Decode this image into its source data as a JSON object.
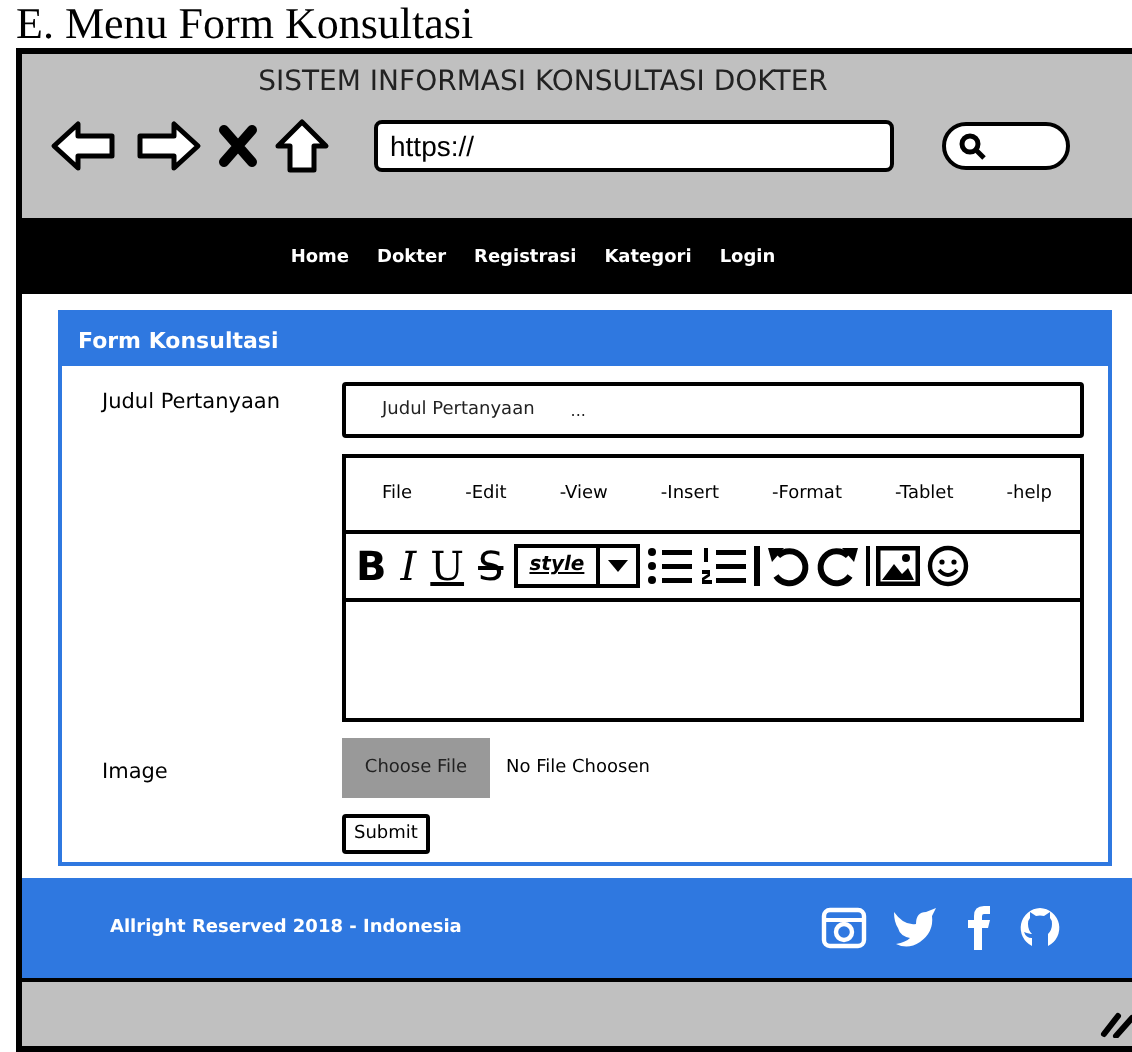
{
  "caption": "E. Menu Form Konsultasi",
  "browser": {
    "title": "SISTEM INFORMASI KONSULTASI DOKTER",
    "url": "https://"
  },
  "nav": [
    "Home",
    "Dokter",
    "Registrasi",
    "Kategori",
    "Login"
  ],
  "form": {
    "title": "Form Konsultasi",
    "question": {
      "label": "Judul Pertanyaan",
      "placeholder": "Judul Pertanyaan",
      "hint": "..."
    },
    "editor": {
      "menu": [
        "File",
        "-Edit",
        "-View",
        "-Insert",
        "-Format",
        "-Tablet",
        "-help"
      ],
      "toolbar": [
        {
          "kind": "bold",
          "glyph": "B"
        },
        {
          "kind": "italic",
          "glyph": "I"
        },
        {
          "kind": "underline",
          "glyph": "U"
        },
        {
          "kind": "strike",
          "glyph": "S"
        },
        {
          "kind": "style",
          "glyph": "style"
        },
        {
          "kind": "bullets"
        },
        {
          "kind": "numbers"
        },
        {
          "kind": "separator"
        },
        {
          "kind": "undo"
        },
        {
          "kind": "redo"
        },
        {
          "kind": "separator"
        },
        {
          "kind": "image"
        },
        {
          "kind": "emoji"
        }
      ]
    },
    "image": {
      "label": "Image",
      "button": "Choose File",
      "status": "No File Choosen"
    },
    "submit": "Submit"
  },
  "footer": "Allright Reserved 2018 - Indonesia"
}
